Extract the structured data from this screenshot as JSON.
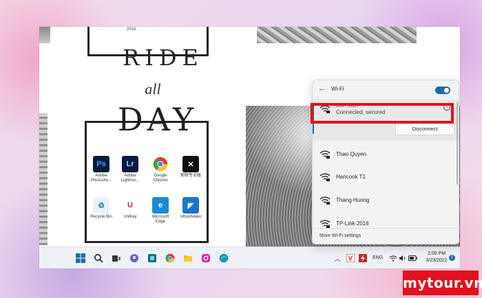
{
  "poster": {
    "year": "2016",
    "word_ride": "RIDE",
    "word_all": "all",
    "word_day": "DAY"
  },
  "desktop_icons": [
    {
      "label": "Adobe Photosho...",
      "icon": "photoshop-icon",
      "glyph": "Ps",
      "color": "#0a1a3a",
      "fg": "#31a8ff"
    },
    {
      "label": "Adobe Lightroo...",
      "icon": "lightroom-icon",
      "glyph": "Lr",
      "color": "#0a1a3a",
      "fg": "#9dd1ff"
    },
    {
      "label": "Google Chrome",
      "icon": "chrome-icon",
      "glyph": "",
      "color": "#ffffff",
      "fg": "#333"
    },
    {
      "label": "剪映专业版",
      "icon": "capcut-icon",
      "glyph": "✕",
      "color": "#111111",
      "fg": "#ffffff"
    },
    {
      "label": "Recycle Bin",
      "icon": "recycle-bin-icon",
      "glyph": "♻",
      "color": "#e9f2fb",
      "fg": "#3b7fc4"
    },
    {
      "label": "UniKey",
      "icon": "unikey-icon",
      "glyph": "U",
      "color": "#ffffff",
      "fg": "#c62828"
    },
    {
      "label": "Microsoft Edge",
      "icon": "edge-icon",
      "glyph": "e",
      "color": "#1b8ad3",
      "fg": "#ffffff"
    },
    {
      "label": "UltraViewer",
      "icon": "ultraviewer-icon",
      "glyph": "◤",
      "color": "#1c74c9",
      "fg": "#ffffff"
    }
  ],
  "wifi": {
    "title": "Wi-Fi",
    "enabled": true,
    "connected": {
      "name": "Bon Muri",
      "status": "Connected, secured"
    },
    "disconnect_label": "Disconnect",
    "networks": [
      "Thao Quyen",
      "Hancook T1",
      "Thang Huong",
      "TP-Link 2016"
    ],
    "more_settings": "More Wi-Fi settings"
  },
  "taskbar": {
    "language": "ENG",
    "time": "2:00 PM",
    "date": "3/23/2022",
    "notifications": "1"
  },
  "brand": "mytour.vn",
  "colors": {
    "accent": "#1b6ca8",
    "highlight": "#e3101e"
  }
}
